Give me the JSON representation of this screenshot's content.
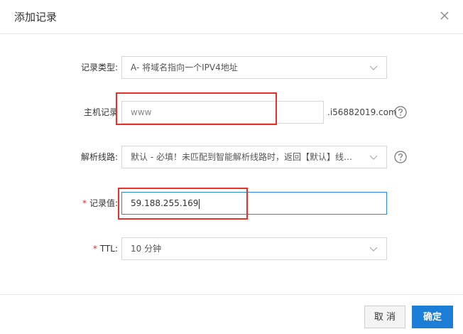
{
  "dialog": {
    "title": "添加记录"
  },
  "form": {
    "record_type": {
      "label": "记录类型:",
      "value": "A- 将域名指向一个IPV4地址"
    },
    "host_record": {
      "label": "主机记录",
      "value": "www",
      "suffix": ".i56882019.com"
    },
    "resolve_line": {
      "label": "解析线路:",
      "value": "默认 - 必填！未匹配到智能解析线路时，返回【默认】线路..."
    },
    "record_value": {
      "required_mark": "*",
      "label": "记录值:",
      "value": "59.188.255.169"
    },
    "ttl": {
      "required_mark": "*",
      "label": "TTL:",
      "value": "10 分钟"
    }
  },
  "footer": {
    "cancel_label": "取 消",
    "ok_label": "确定"
  },
  "colors": {
    "primary": "#1c7ed6",
    "focus_border": "#2b8bd9",
    "highlight_box": "#e6332a",
    "required": "#d9312b"
  },
  "icons": [
    "close-icon",
    "chevron-down-icon",
    "help-circle-icon"
  ]
}
